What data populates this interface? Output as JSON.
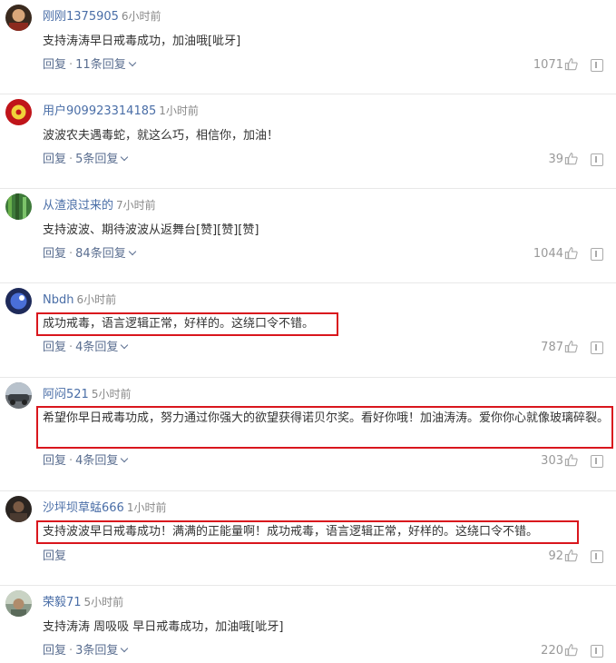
{
  "labels": {
    "reply": "回复",
    "sep": "·"
  },
  "comments": [
    {
      "user": "刚刚1375905",
      "time": "6小时前",
      "text": "支持涛涛早日戒毒成功，加油哦[呲牙]",
      "replies": "11条回复",
      "likes": "1071",
      "highlighted": false,
      "avatar_color": "#3a2a1e"
    },
    {
      "user": "用户909923314185",
      "time": "1小时前",
      "text": "波波农夫遇毒蛇，就这么巧，相信你，加油！",
      "replies": "5条回复",
      "likes": "39",
      "highlighted": false,
      "avatar_color": "#c0151a"
    },
    {
      "user": "从渣浪过来的",
      "time": "7小时前",
      "text": "支持波波、期待波波从返舞台[赞][赞][赞]",
      "replies": "84条回复",
      "likes": "1044",
      "highlighted": false,
      "avatar_color": "#3e7a3a"
    },
    {
      "user": "Nbdh",
      "time": "6小时前",
      "text": "成功戒毒，语言逻辑正常，好样的。这绕口令不错。",
      "replies": "4条回复",
      "likes": "787",
      "highlighted": true,
      "avatar_color": "#1e2a5a"
    },
    {
      "user": "阿闷521",
      "time": "5小时前",
      "text": "希望你早日戒毒功成，努力通过你强大的欲望获得诺贝尔奖。看好你哦！加油涛涛。爱你你心就像玻璃碎裂。",
      "replies": "4条回复",
      "likes": "303",
      "highlighted": true,
      "avatar_color": "#6a6f74"
    },
    {
      "user": "沙坪坝草蜢666",
      "time": "1小时前",
      "text": "支持波波早日戒毒成功！满满的正能量啊！成功戒毒，语言逻辑正常，好样的。这绕口令不错。",
      "replies": "",
      "likes": "92",
      "highlighted": true,
      "avatar_color": "#2a2420"
    },
    {
      "user": "荣毅71",
      "time": "5小时前",
      "text": "支持涛涛 周吸吸 早日戒毒成功，加油哦[呲牙]",
      "replies": "3条回复",
      "likes": "220",
      "highlighted": false,
      "avatar_color": "#8a9a8a"
    }
  ]
}
